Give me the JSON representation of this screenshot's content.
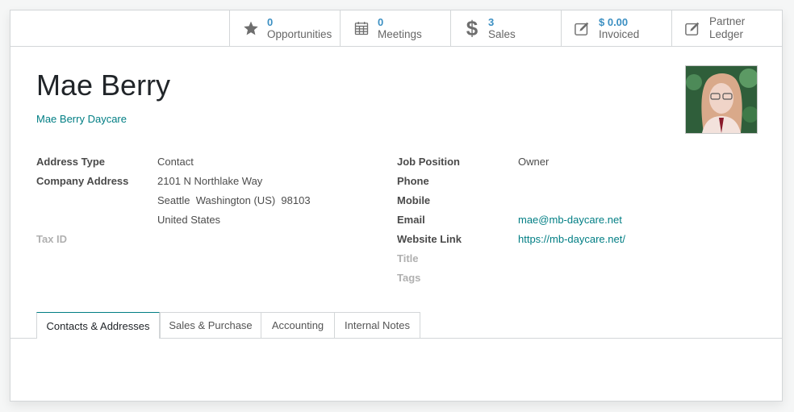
{
  "stat_buttons": [
    {
      "icon": "star-icon",
      "value": "0",
      "label": "Opportunities"
    },
    {
      "icon": "calendar-icon",
      "value": "0",
      "label": "Meetings"
    },
    {
      "icon": "dollar-icon",
      "value": "3",
      "label": "Sales"
    },
    {
      "icon": "edit-icon",
      "value": "$ 0.00",
      "label": "Invoiced"
    },
    {
      "icon": "edit-icon",
      "line1": "Partner",
      "line2": "Ledger"
    }
  ],
  "partner": {
    "name": "Mae Berry",
    "company": "Mae Berry Daycare"
  },
  "left_fields": {
    "address_type_label": "Address Type",
    "address_type": "Contact",
    "company_address_label": "Company Address",
    "street": "2101 N Northlake Way",
    "city_line": "Seattle  Washington (US)  98103",
    "country": "United States",
    "tax_id_label": "Tax ID"
  },
  "right_fields": {
    "job_position_label": "Job Position",
    "job_position": "Owner",
    "phone_label": "Phone",
    "mobile_label": "Mobile",
    "email_label": "Email",
    "email": "mae@mb-daycare.net",
    "website_label": "Website Link",
    "website": "https://mb-daycare.net/",
    "title_label": "Title",
    "tags_label": "Tags"
  },
  "tabs": [
    {
      "label": "Contacts & Addresses",
      "active": true
    },
    {
      "label": "Sales & Purchase"
    },
    {
      "label": "Accounting"
    },
    {
      "label": "Internal Notes"
    }
  ],
  "colors": {
    "accent": "#017e84",
    "stat_value": "#3b8fc2"
  }
}
